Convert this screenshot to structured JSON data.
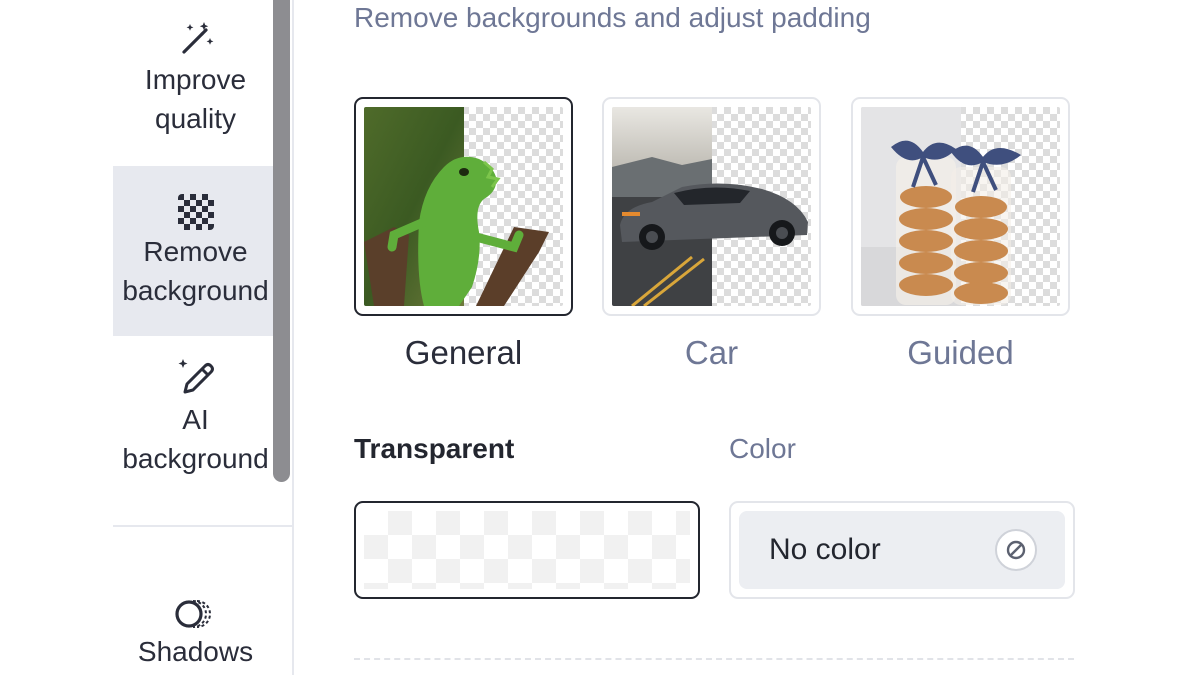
{
  "sidebar": {
    "items": [
      {
        "label_line1": "Improve",
        "label_line2": "quality",
        "icon": "magic-wand-icon"
      },
      {
        "label_line1": "Remove",
        "label_line2": "background",
        "icon": "checkerboard-icon",
        "active": true
      },
      {
        "label_line1": "AI",
        "label_line2": "background",
        "icon": "ai-pencil-icon"
      },
      {
        "label_line1": "Shadows",
        "icon": "shadows-icon"
      }
    ]
  },
  "main": {
    "subtitle": "Remove backgrounds and adjust padding",
    "modes": [
      {
        "label": "General",
        "selected": true
      },
      {
        "label": "Car",
        "selected": false
      },
      {
        "label": "Guided",
        "selected": false
      }
    ],
    "background_tabs": {
      "transparent": "Transparent",
      "color": "Color",
      "selected": "transparent"
    },
    "color_picker": {
      "value": "No color",
      "icon": "no-color-icon"
    }
  },
  "colors": {
    "text_primary": "#2a2d3a",
    "text_muted": "#6e7795",
    "selected_border": "#23262f",
    "sidebar_active_bg": "#e7e9ef"
  }
}
